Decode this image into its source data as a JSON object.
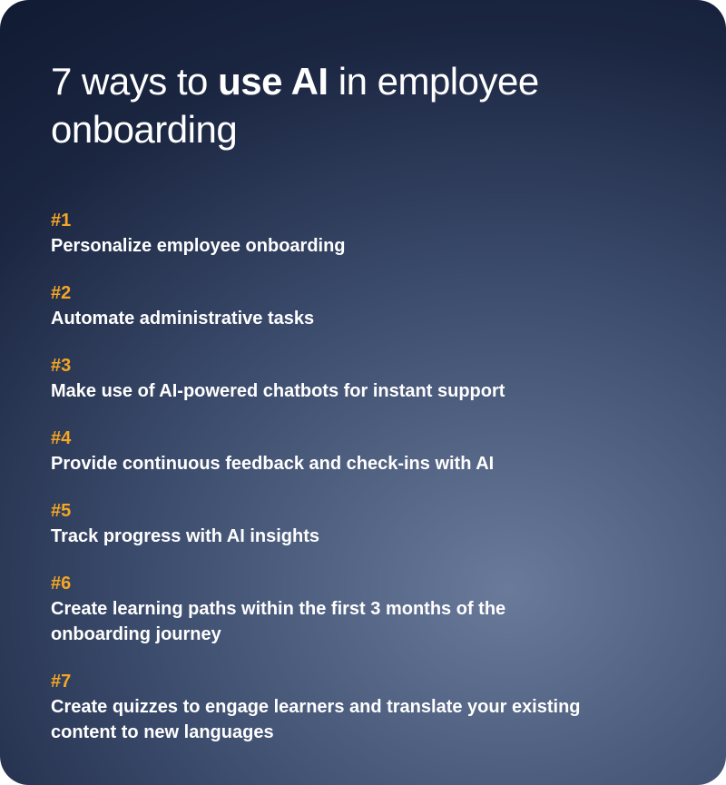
{
  "title": {
    "pre": "7 ways to ",
    "bold": "use AI",
    "post": " in employee onboarding"
  },
  "items": [
    {
      "num": "#1",
      "text": "Personalize employee onboarding"
    },
    {
      "num": "#2",
      "text": "Automate administrative tasks"
    },
    {
      "num": "#3",
      "text": "Make use of AI-powered chatbots for instant support"
    },
    {
      "num": "#4",
      "text": "Provide continuous feedback and check-ins with AI"
    },
    {
      "num": "#5",
      "text": "Track progress with AI insights"
    },
    {
      "num": "#6",
      "text": "Create learning paths within the first 3 months of the onboarding journey"
    },
    {
      "num": "#7",
      "text": "Create quizzes to engage learners and translate your existing content to new languages"
    }
  ],
  "colors": {
    "accent": "#f5a623",
    "text": "#ffffff"
  }
}
